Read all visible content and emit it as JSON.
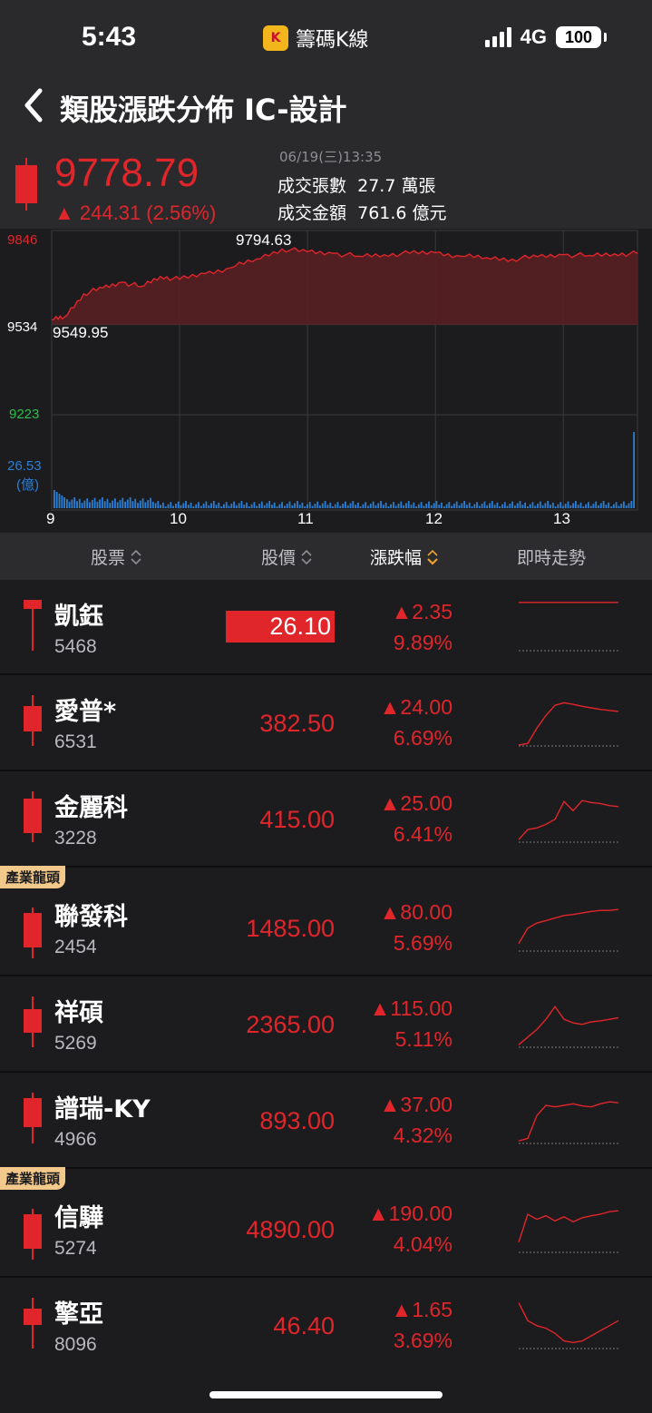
{
  "status": {
    "time": "5:43",
    "app_name": "籌碼K線",
    "app_logo_text": "K",
    "network": "4G",
    "battery": "100"
  },
  "header": {
    "title": "類股漲跌分佈  IC-設計"
  },
  "quote": {
    "price": "9778.79",
    "change": "▲ 244.31 (2.56%)",
    "datetime": "06/19(三)13:35",
    "volume_label": "成交張數",
    "volume_value": "27.7 萬張",
    "amount_label": "成交金額",
    "amount_value": "761.6 億元",
    "up_color": "#e0252b"
  },
  "chart_data": {
    "type": "line",
    "y_ticks": [
      "9846",
      "9534",
      "9223"
    ],
    "y_tick_values": [
      9846,
      9534,
      9223
    ],
    "volume_tick": "26.53",
    "volume_unit": "(億)",
    "x_ticks": [
      "9",
      "10",
      "11",
      "12",
      "13"
    ],
    "high_label": "9794.63",
    "low_label": "9549.95",
    "reference": 9534,
    "ylim": [
      9223,
      9846
    ],
    "series": [
      {
        "x": [
          9.0,
          9.1,
          9.25,
          9.4,
          9.55,
          9.7,
          9.85,
          10.0,
          10.2,
          10.4,
          10.6,
          10.8,
          11.0,
          11.2,
          11.4,
          11.6,
          11.8,
          12.0,
          12.2,
          12.4,
          12.6,
          12.8,
          13.0,
          13.2,
          13.4,
          13.58
        ],
        "y": [
          9549.95,
          9560,
          9640,
          9660,
          9680,
          9665,
          9700,
          9690,
          9710,
          9730,
          9760,
          9794.63,
          9785,
          9780,
          9770,
          9775,
          9780,
          9782,
          9770,
          9765,
          9760,
          9768,
          9775,
          9772,
          9778,
          9778.79
        ]
      }
    ]
  },
  "table": {
    "columns": [
      "股票",
      "股價",
      "漲跌幅",
      "即時走勢"
    ],
    "rows": [
      {
        "name": "凱鈺",
        "code": "5468",
        "price": "26.10",
        "change": "▲2.35",
        "pct": "9.89%",
        "badge": "",
        "limit_up": true,
        "spark": [
          0.95,
          0.95,
          0.95,
          0.95,
          0.95,
          0.95,
          0.95,
          0.95,
          0.95,
          0.95,
          0.95,
          0.95
        ]
      },
      {
        "name": "愛普*",
        "code": "6531",
        "price": "382.50",
        "change": "▲24.00",
        "pct": "6.69%",
        "badge": "",
        "limit_up": false,
        "spark": [
          0.02,
          0.05,
          0.35,
          0.6,
          0.8,
          0.85,
          0.82,
          0.78,
          0.75,
          0.72,
          0.7,
          0.68
        ]
      },
      {
        "name": "金麗科",
        "code": "3228",
        "price": "415.00",
        "change": "▲25.00",
        "pct": "6.41%",
        "badge": "",
        "limit_up": false,
        "spark": [
          0.05,
          0.25,
          0.28,
          0.35,
          0.45,
          0.8,
          0.62,
          0.82,
          0.78,
          0.76,
          0.72,
          0.7
        ]
      },
      {
        "name": "聯發科",
        "code": "2454",
        "price": "1485.00",
        "change": "▲80.00",
        "pct": "5.69%",
        "badge": "產業龍頭",
        "limit_up": false,
        "spark": [
          0.15,
          0.45,
          0.55,
          0.6,
          0.65,
          0.7,
          0.72,
          0.75,
          0.78,
          0.8,
          0.8,
          0.82
        ]
      },
      {
        "name": "祥碩",
        "code": "5269",
        "price": "2365.00",
        "change": "▲115.00",
        "pct": "5.11%",
        "badge": "",
        "limit_up": false,
        "spark": [
          0.05,
          0.2,
          0.35,
          0.55,
          0.8,
          0.55,
          0.48,
          0.45,
          0.5,
          0.52,
          0.55,
          0.58
        ]
      },
      {
        "name": "譜瑞-KY",
        "code": "4966",
        "price": "893.00",
        "change": "▲37.00",
        "pct": "4.32%",
        "badge": "",
        "limit_up": false,
        "spark": [
          0.05,
          0.1,
          0.55,
          0.75,
          0.72,
          0.75,
          0.78,
          0.74,
          0.72,
          0.78,
          0.82,
          0.8
        ]
      },
      {
        "name": "信驊",
        "code": "5274",
        "price": "4890.00",
        "change": "▲190.00",
        "pct": "4.04%",
        "badge": "產業龍頭",
        "limit_up": false,
        "spark": [
          0.2,
          0.75,
          0.65,
          0.72,
          0.62,
          0.7,
          0.6,
          0.68,
          0.72,
          0.75,
          0.8,
          0.82
        ]
      },
      {
        "name": "擎亞",
        "code": "8096",
        "price": "46.40",
        "change": "▲1.65",
        "pct": "3.69%",
        "badge": "",
        "limit_up": false,
        "spark": [
          0.9,
          0.55,
          0.45,
          0.4,
          0.3,
          0.15,
          0.12,
          0.15,
          0.25,
          0.35,
          0.45,
          0.55
        ]
      }
    ]
  },
  "colors": {
    "up": "#e0252b",
    "down": "#2bbf4f",
    "grid": "#3a3a3c",
    "volume": "#2a7fd4",
    "badge": "#f3c98b"
  }
}
